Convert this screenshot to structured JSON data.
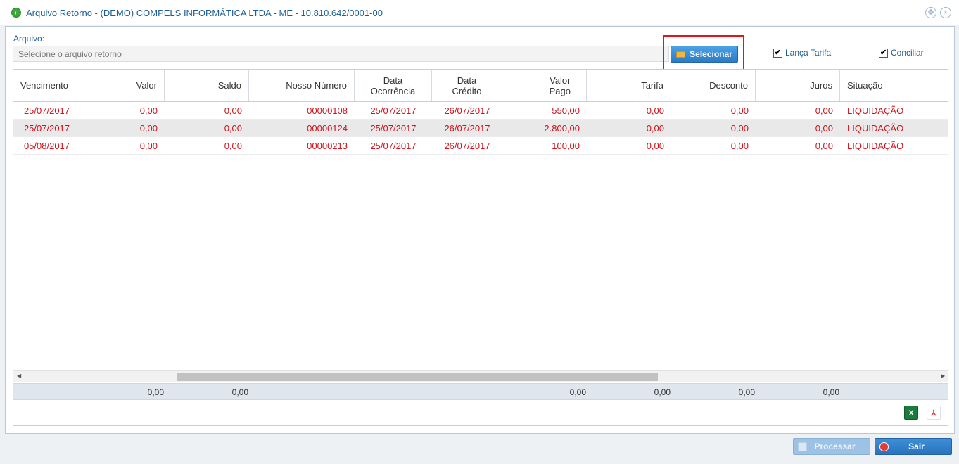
{
  "window": {
    "title": "Arquivo Retorno - (DEMO) COMPELS INFORMÁTICA LTDA - ME - 10.810.642/0001-00",
    "title_icon": "green-circle-icon",
    "restore_icon": "restore-icon",
    "close_icon": "close-icon"
  },
  "file": {
    "label": "Arquivo:",
    "placeholder": "Selecione o arquivo retorno",
    "select_button": "Selecionar"
  },
  "options": {
    "lanca_tarifa": {
      "label": "Lança Tarifa",
      "checked": true,
      "mark": "✔"
    },
    "conciliar": {
      "label": "Conciliar",
      "checked": true,
      "mark": "✔"
    }
  },
  "grid": {
    "columns": [
      {
        "line1": "Vencimento",
        "line2": ""
      },
      {
        "line1": "Valor",
        "line2": ""
      },
      {
        "line1": "Saldo",
        "line2": ""
      },
      {
        "line1": "Nosso Número",
        "line2": ""
      },
      {
        "line1": "Data",
        "line2": "Ocorrência"
      },
      {
        "line1": "Data",
        "line2": "Crédito"
      },
      {
        "line1": "Valor",
        "line2": "Pago"
      },
      {
        "line1": "Tarifa",
        "line2": ""
      },
      {
        "line1": "Desconto",
        "line2": ""
      },
      {
        "line1": "Juros",
        "line2": ""
      },
      {
        "line1": "Situação",
        "line2": ""
      }
    ],
    "rows": [
      [
        "25/07/2017",
        "0,00",
        "0,00",
        "00000108",
        "25/07/2017",
        "26/07/2017",
        "550,00",
        "0,00",
        "0,00",
        "0,00",
        "LIQUIDAÇÃO"
      ],
      [
        "25/07/2017",
        "0,00",
        "0,00",
        "00000124",
        "25/07/2017",
        "26/07/2017",
        "2.800,00",
        "0,00",
        "0,00",
        "0,00",
        "LIQUIDAÇÃO"
      ],
      [
        "05/08/2017",
        "0,00",
        "0,00",
        "00000213",
        "25/07/2017",
        "26/07/2017",
        "100,00",
        "0,00",
        "0,00",
        "0,00",
        "LIQUIDAÇÃO"
      ]
    ],
    "totals": {
      "valor": "0,00",
      "saldo": "0,00",
      "valor_pago": "0,00",
      "tarifa": "0,00",
      "desconto": "0,00",
      "juros": "0,00"
    },
    "row_text_color": "#d0121b"
  },
  "export": {
    "excel_icon_text": "X",
    "pdf_icon_text": "⅄"
  },
  "actions": {
    "processar": "Processar",
    "sair": "Sair"
  }
}
